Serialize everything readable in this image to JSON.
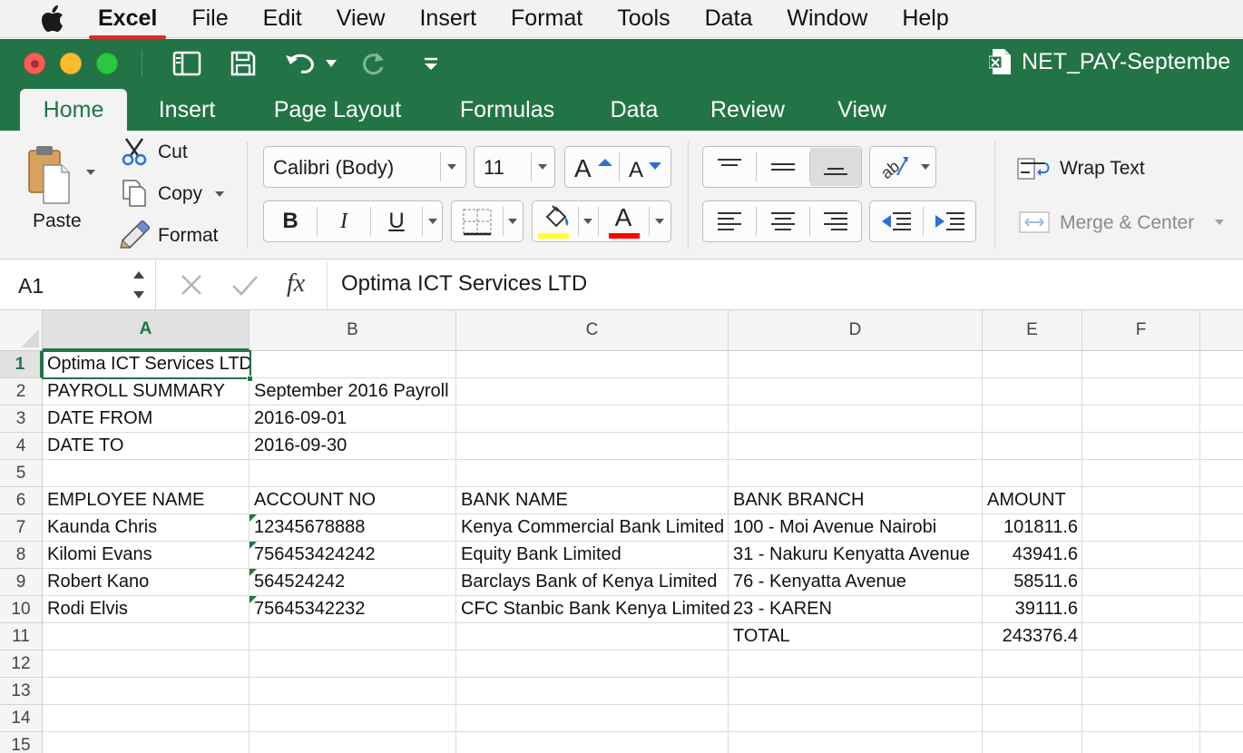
{
  "menubar": {
    "app": "Excel",
    "items": [
      "File",
      "Edit",
      "View",
      "Insert",
      "Format",
      "Tools",
      "Data",
      "Window",
      "Help"
    ]
  },
  "window": {
    "title": "NET_PAY-Septembe"
  },
  "ribbon_tabs": [
    {
      "label": "Home",
      "active": true
    },
    {
      "label": "Insert"
    },
    {
      "label": "Page Layout"
    },
    {
      "label": "Formulas"
    },
    {
      "label": "Data"
    },
    {
      "label": "Review"
    },
    {
      "label": "View"
    }
  ],
  "ribbon": {
    "paste": "Paste",
    "cut": "Cut",
    "copy": "Copy",
    "format": "Format",
    "font_name": "Calibri (Body)",
    "font_size": "11",
    "bold": "B",
    "italic": "I",
    "underline": "U",
    "wrap_text": "Wrap Text",
    "merge_center": "Merge & Center",
    "fill_color": "#ffff33",
    "font_color": "#ff0000"
  },
  "formula_bar": {
    "name_box": "A1",
    "fx": "fx",
    "content": "Optima ICT Services LTD"
  },
  "sheet": {
    "columns": [
      "A",
      "B",
      "C",
      "D",
      "E",
      "F"
    ],
    "rows": [
      "1",
      "2",
      "3",
      "4",
      "5",
      "6",
      "7",
      "8",
      "9",
      "10",
      "11",
      "12",
      "13",
      "14",
      "15"
    ],
    "selected_cell": "A1",
    "cells": {
      "r1": {
        "A": "Optima ICT Services LTD"
      },
      "r2": {
        "A": "PAYROLL SUMMARY",
        "B": "September 2016 Payroll"
      },
      "r3": {
        "A": "DATE FROM",
        "B": "2016-09-01"
      },
      "r4": {
        "A": "DATE TO",
        "B": "2016-09-30"
      },
      "r6": {
        "A": "EMPLOYEE NAME",
        "B": "ACCOUNT NO",
        "C": "BANK NAME",
        "D": "BANK BRANCH",
        "E": "AMOUNT"
      },
      "r7": {
        "A": "Kaunda Chris",
        "B": "12345678888",
        "C": "Kenya Commercial Bank Limited",
        "D": "100 - Moi Avenue Nairobi",
        "E": "101811.6"
      },
      "r8": {
        "A": "Kilomi Evans",
        "B": "756453424242",
        "C": "Equity Bank Limited",
        "D": "31 - Nakuru Kenyatta Avenue",
        "E": "43941.6"
      },
      "r9": {
        "A": "Robert Kano",
        "B": "564524242",
        "C": "Barclays Bank of Kenya Limited",
        "D": "76 - Kenyatta Avenue",
        "E": "58511.6"
      },
      "r10": {
        "A": "Rodi Elvis",
        "B": "75645342232",
        "C": "CFC Stanbic Bank Kenya Limited",
        "D": "23 - KAREN",
        "E": "39111.6"
      },
      "r11": {
        "D": "TOTAL",
        "E": "243376.4"
      }
    }
  }
}
